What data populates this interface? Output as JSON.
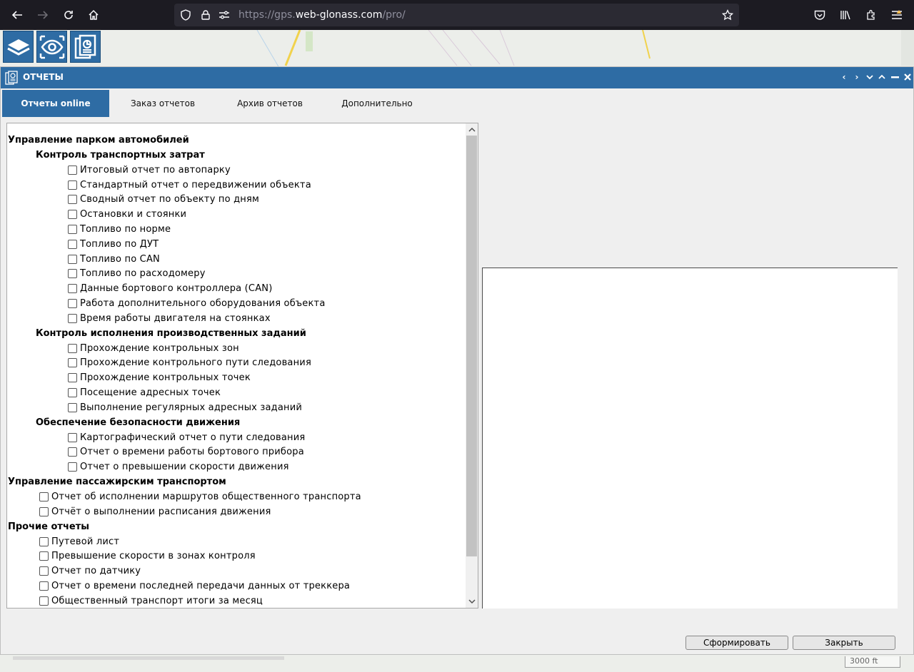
{
  "browser": {
    "url_prefix": "https://gps.",
    "url_host": "web-glonass.com",
    "url_path": "/pro/"
  },
  "window": {
    "title": "ОТЧЕТЫ",
    "accent_color": "#2e6ca4"
  },
  "tabs": [
    {
      "label": "Отчеты online",
      "active": true
    },
    {
      "label": "Заказ отчетов",
      "active": false
    },
    {
      "label": "Архив отчетов",
      "active": false
    },
    {
      "label": "Дополнительно",
      "active": false
    }
  ],
  "report_tree": {
    "g1": {
      "title": "Управление парком автомобилей",
      "sub1": {
        "title": "Контроль транспортных затрат",
        "items": [
          "Итоговый отчет по автопарку",
          "Стандартный отчет о передвижении объекта",
          "Сводный отчет по объекту по дням",
          "Остановки и стоянки",
          "Топливо по норме",
          "Топливо по ДУТ",
          "Топливо по CAN",
          "Топливо по расходомеру",
          "Данные бортового контроллера (CAN)",
          "Работа дополнительного оборудования объекта",
          "Время работы двигателя на стоянках"
        ]
      },
      "sub2": {
        "title": "Контроль исполнения производственных заданий",
        "items": [
          "Прохождение контрольных зон",
          "Прохождение контрольного пути следования",
          "Прохождение контрольных точек",
          "Посещение адресных точек",
          "Выполнение регулярных адресных заданий"
        ]
      },
      "sub3": {
        "title": "Обеспечение безопасности движения",
        "items": [
          "Картографический отчет о пути следования",
          "Отчет о времени работы бортового прибора",
          "Отчет о превышении скорости движения"
        ]
      }
    },
    "g2": {
      "title": "Управление пассажирским транспортом",
      "items": [
        "Отчет об исполнении маршрутов общественного транспорта",
        "Отчёт о выполнении расписания движения"
      ]
    },
    "g3": {
      "title": "Прочие отчеты",
      "items": [
        "Путевой лист",
        "Превышение скорости в зонах контроля",
        "Отчет по датчику",
        "Отчет о времени последней передачи данных от треккера",
        "Общественный транспорт итоги за месяц"
      ]
    }
  },
  "buttons": {
    "generate": "Сформировать",
    "close": "Закрыть"
  },
  "map": {
    "scale_label": "3000 ft"
  }
}
